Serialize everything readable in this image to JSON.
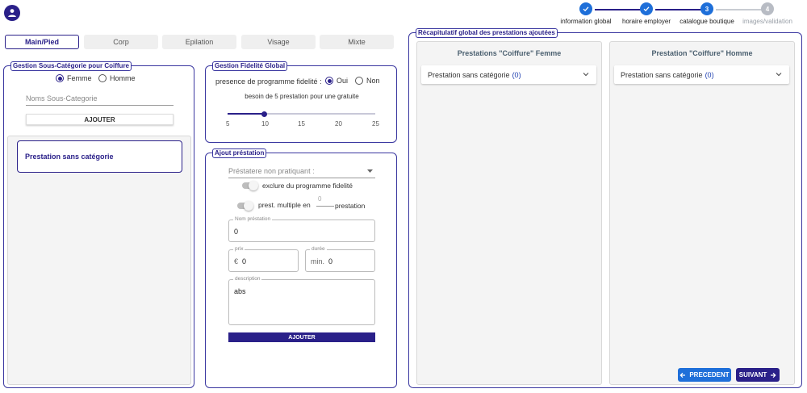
{
  "stepper": {
    "steps": [
      {
        "label": "information global",
        "state": "done",
        "number": ""
      },
      {
        "label": "horaire employer",
        "state": "done",
        "number": ""
      },
      {
        "label": "catalogue boutique",
        "state": "active",
        "number": "3"
      },
      {
        "label": "images/validation",
        "state": "pending",
        "number": "4"
      }
    ],
    "colors": {
      "done": "#1e6fd9",
      "pending": "#b8bcc4"
    }
  },
  "tabs": [
    {
      "label": "Main/Pied",
      "active": true
    },
    {
      "label": "Corp",
      "active": false
    },
    {
      "label": "Epilation",
      "active": false
    },
    {
      "label": "Visage",
      "active": false
    },
    {
      "label": "Mixte",
      "active": false
    }
  ],
  "sous_categorie": {
    "title": "Gestion Sous-Catégorie pour Coiffure",
    "gender_options": [
      {
        "label": "Femme",
        "checked": true
      },
      {
        "label": "Homme",
        "checked": false
      }
    ],
    "name_placeholder": "Noms Sous-Categorie",
    "add_button": "AJOUTER",
    "categories": [
      "Prestation sans catégorie"
    ]
  },
  "fidelite": {
    "title": "Gestion Fidelité Global",
    "question": "presence de programme fidelité :",
    "options": [
      {
        "label": "Oui",
        "checked": true
      },
      {
        "label": "Non",
        "checked": false
      }
    ],
    "need_text": "besoin de 5 prestation pour une gratuite",
    "slider": {
      "ticks": [
        "5",
        "10",
        "15",
        "20",
        "25"
      ],
      "min": 5,
      "max": 25,
      "value": 10
    }
  },
  "ajout": {
    "title": "Ajout préstation",
    "provider_placeholder": "Préstatere non pratiquant :",
    "exclude_label": "exclure du programme fidelité",
    "multiple_label": "prest. multiple en",
    "multiple_value": "0",
    "multiple_suffix": "prestation",
    "name_label": "Nom préstation",
    "name_value": "0",
    "price_label": "prix",
    "price_prefix": "€",
    "price_value": "0",
    "duration_label": "durée",
    "duration_prefix": "min.",
    "duration_value": "0",
    "description_label": "description",
    "description_value": "abs",
    "add_button": "AJOUTER"
  },
  "recap": {
    "title": "Récapitulatif global des prestations ajoutées",
    "femme": {
      "title": "Prestations \"Coiffure\" Femme",
      "items": [
        {
          "label": "Prestation sans catégorie",
          "count": "(0)"
        }
      ]
    },
    "homme": {
      "title": "Prestation \"Coiffure\" Homme",
      "items": [
        {
          "label": "Prestation sans catégorie",
          "count": "(0)"
        }
      ]
    },
    "prev_button": "PRECEDENT",
    "next_button": "SUIVANT",
    "colors": {
      "prev": "#1e6fd9",
      "next": "#2a2089"
    }
  }
}
